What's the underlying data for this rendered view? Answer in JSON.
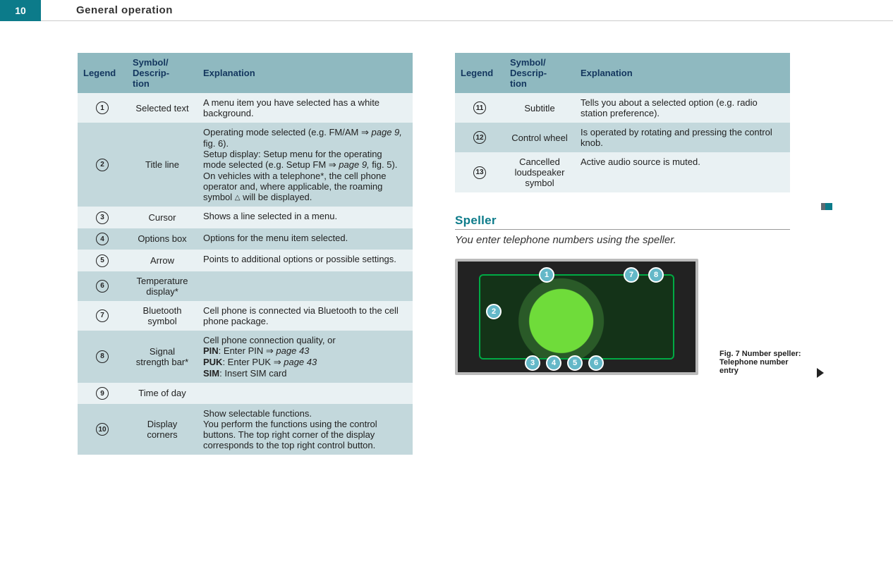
{
  "page_number": "10",
  "chapter_title": "General operation",
  "tables": {
    "headers": {
      "legend": "Legend",
      "symbol": "Symbol/\nDescrip-\ntion",
      "explanation": "Explanation"
    }
  },
  "left_rows": [
    {
      "num": "1",
      "symbol": "Selected text",
      "expl_html": "A menu item you have selected has a white background."
    },
    {
      "num": "2",
      "symbol": "Title line",
      "expl_html": "Operating mode selected (e.g. FM/AM <span class='arrow-ref'>⇒</span> <span class='ital'>page 9,</span> fig. 6).<br>Setup display: Setup menu for the operating mode selected (e.g. Setup FM <span class='arrow-ref'>⇒</span> <span class='ital'>page 9,</span> fig. 5).<br>On vehicles with a telephone*, the cell phone operator and, where applicable, the roaming symbol <span class='tri-char'>△</span> will be displayed."
    },
    {
      "num": "3",
      "symbol": "Cursor",
      "expl_html": "Shows a line selected in a menu."
    },
    {
      "num": "4",
      "symbol": "Options box",
      "expl_html": "Options for the menu item selected."
    },
    {
      "num": "5",
      "symbol": "Arrow",
      "expl_html": "Points to additional options or possible settings."
    },
    {
      "num": "6",
      "symbol": "Temperature display*",
      "expl_html": ""
    },
    {
      "num": "7",
      "symbol": "Bluetooth symbol",
      "expl_html": "Cell phone is connected via Bluetooth to the cell phone package."
    },
    {
      "num": "8",
      "symbol": "Signal strength bar*",
      "expl_html": "Cell phone connection quality, or<br><b>PIN</b>: Enter PIN <span class='arrow-ref'>⇒</span> <span class='ital'>page 43</span><br><b>PUK</b>: Enter PUK <span class='arrow-ref'>⇒</span> <span class='ital'>page 43</span><br><b>SIM</b>: Insert SIM card"
    },
    {
      "num": "9",
      "symbol": "Time of day",
      "expl_html": ""
    },
    {
      "num": "10",
      "symbol": "Display corners",
      "expl_html": "Show selectable functions.<br>You perform the functions using the control buttons. The top right corner of the display corresponds to the top right control button."
    }
  ],
  "right_rows": [
    {
      "num": "11",
      "symbol": "Subtitle",
      "expl_html": "Tells you about a selected option (e.g. radio station preference)."
    },
    {
      "num": "12",
      "symbol": "Control wheel",
      "expl_html": "Is operated by rotating and pressing the control knob."
    },
    {
      "num": "13",
      "symbol": "Cancelled loudspeaker symbol",
      "expl_html": "Active audio source is muted."
    }
  ],
  "speller": {
    "heading": "Speller",
    "subtitle": "You enter telephone numbers using the speller.",
    "caption": "Fig. 7   Number speller: Telephone number entry",
    "circles": [
      "1",
      "2",
      "3",
      "4",
      "5",
      "6",
      "7",
      "8"
    ]
  }
}
